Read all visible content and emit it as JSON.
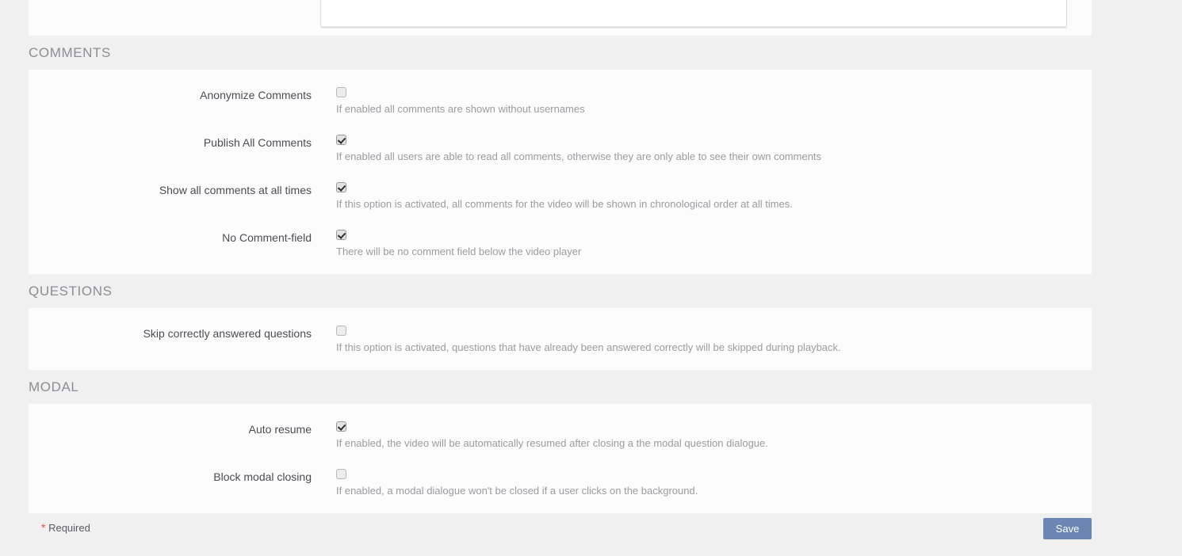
{
  "editor": {
    "textarea_value": ""
  },
  "sections": [
    {
      "id": "comments",
      "title": "COMMENTS",
      "rows": [
        {
          "label": "Anonymize Comments",
          "checked": false,
          "help": "If enabled all comments are shown without usernames"
        },
        {
          "label": "Publish All Comments",
          "checked": true,
          "help": "If enabled all users are able to read all comments, otherwise they are only able to see their own comments"
        },
        {
          "label": "Show all comments at all times",
          "checked": true,
          "help": "If this option is activated, all comments for the video will be shown in chronological order at all times."
        },
        {
          "label": "No Comment-field",
          "checked": true,
          "help": "There will be no comment field below the video player"
        }
      ]
    },
    {
      "id": "questions",
      "title": "QUESTIONS",
      "rows": [
        {
          "label": "Skip correctly answered questions",
          "checked": false,
          "help": "If this option is activated, questions that have already been answered correctly will be skipped during playback."
        }
      ]
    },
    {
      "id": "modal",
      "title": "MODAL",
      "rows": [
        {
          "label": "Auto resume",
          "checked": true,
          "help": "If enabled, the video will be automatically resumed after closing a the modal question dialogue."
        },
        {
          "label": "Block modal closing",
          "checked": false,
          "help": "If enabled, a modal dialogue won't be closed if a user clicks on the background."
        }
      ]
    }
  ],
  "footer": {
    "required_star": "*",
    "required_label": "Required",
    "save_label": "Save"
  },
  "colors": {
    "page_background": "#f0f0f0",
    "panel_background": "#fcfcfc",
    "label_text": "#4c4c55",
    "help_text": "#9b9ba1",
    "section_title": "#8d8d94",
    "save_button": "#6b86b3",
    "required_star": "#e8534f"
  }
}
